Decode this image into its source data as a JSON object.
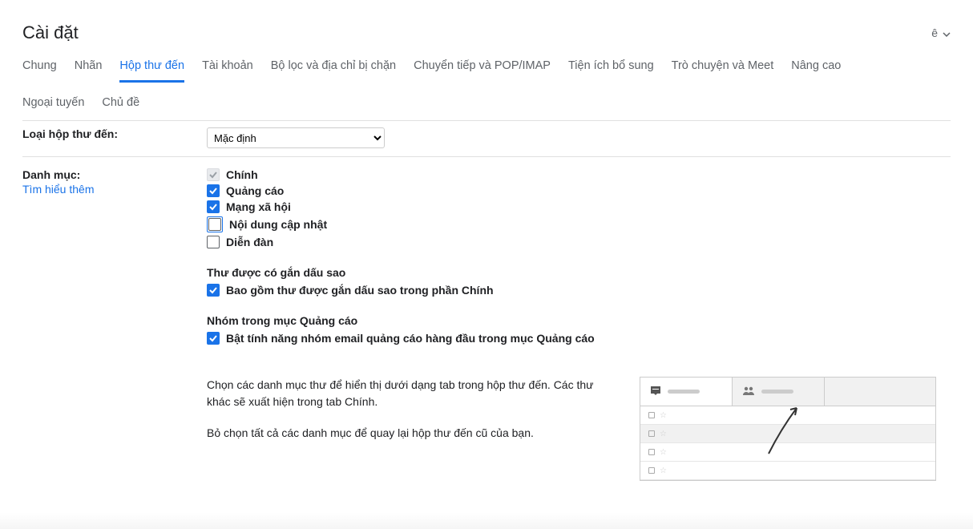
{
  "header": {
    "title": "Cài đặt",
    "input_tool_label": "ê"
  },
  "tabs": [
    {
      "label": "Chung",
      "active": false
    },
    {
      "label": "Nhãn",
      "active": false
    },
    {
      "label": "Hộp thư đến",
      "active": true
    },
    {
      "label": "Tài khoản",
      "active": false
    },
    {
      "label": "Bộ lọc và địa chỉ bị chặn",
      "active": false
    },
    {
      "label": "Chuyển tiếp và POP/IMAP",
      "active": false
    },
    {
      "label": "Tiện ích bổ sung",
      "active": false
    },
    {
      "label": "Trò chuyện và Meet",
      "active": false
    },
    {
      "label": "Nâng cao",
      "active": false
    },
    {
      "label": "Ngoại tuyến",
      "active": false
    },
    {
      "label": "Chủ đề",
      "active": false
    }
  ],
  "inbox_type": {
    "label": "Loại hộp thư đến:",
    "selected": "Mặc định"
  },
  "categories": {
    "label": "Danh mục:",
    "learn_more": "Tìm hiểu thêm",
    "items": [
      {
        "label": "Chính",
        "checked": true,
        "disabled": true,
        "focus": false
      },
      {
        "label": "Quảng cáo",
        "checked": true,
        "disabled": false,
        "focus": false
      },
      {
        "label": "Mạng xã hội",
        "checked": true,
        "disabled": false,
        "focus": false
      },
      {
        "label": "Nội dung cập nhật",
        "checked": false,
        "disabled": false,
        "focus": true
      },
      {
        "label": "Diễn đàn",
        "checked": false,
        "disabled": false,
        "focus": false
      }
    ],
    "starred_heading": "Thư được có gắn dấu sao",
    "starred_option": {
      "label": "Bao gồm thư được gắn dấu sao trong phần Chính",
      "checked": true
    },
    "bundling_heading": "Nhóm trong mục Quảng cáo",
    "bundling_option": {
      "label": "Bật tính năng nhóm email quảng cáo hàng đầu trong mục Quảng cáo",
      "checked": true
    },
    "description1": "Chọn các danh mục thư để hiển thị dưới dạng tab trong hộp thư đến. Các thư khác sẽ xuất hiện trong tab Chính.",
    "description2": "Bỏ chọn tất cả các danh mục để quay lại hộp thư đến cũ của bạn."
  }
}
